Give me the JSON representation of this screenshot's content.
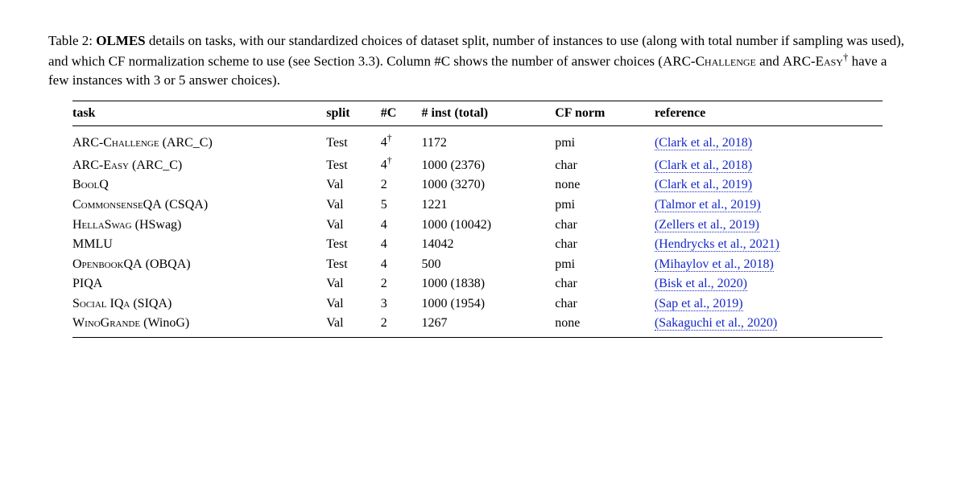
{
  "caption": {
    "prefix": "Table 2: ",
    "bold_name": "OLMES",
    "text_after_bold": " details on tasks, with our standardized choices of dataset split, number of instances to use (along with total number if sampling was used), and which CF normalization scheme to use (see Section 3.3). Column #C shows the number of answer choices (",
    "task1_sc": "ARC-Challenge",
    "and_word": " and ",
    "task2_sc": "ARC-Easy",
    "dagger": "†",
    "text_tail": " have a few instances with 3 or 5 answer choices)."
  },
  "headers": {
    "task": "task",
    "split": "split",
    "nc": "#C",
    "ninst": "# inst (total)",
    "cfnorm": "CF norm",
    "reference": "reference"
  },
  "rows": [
    {
      "task_main": "ARC-Challenge",
      "alias": "ARC_C",
      "no_sc": false,
      "split": "Test",
      "nc": "4",
      "dag": true,
      "ninst": "1172",
      "cfnorm": "pmi",
      "reference": "(Clark et al., 2018)"
    },
    {
      "task_main": "ARC-Easy",
      "alias": "ARC_C",
      "no_sc": false,
      "split": "Test",
      "nc": "4",
      "dag": true,
      "ninst": "1000 (2376)",
      "cfnorm": "char",
      "reference": "(Clark et al., 2018)"
    },
    {
      "task_main": "BoolQ",
      "alias": "",
      "no_sc": false,
      "split": "Val",
      "nc": "2",
      "dag": false,
      "ninst": "1000 (3270)",
      "cfnorm": "none",
      "reference": "(Clark et al., 2019)"
    },
    {
      "task_main": "CommonsenseQA",
      "alias": "CSQA",
      "no_sc": false,
      "split": "Val",
      "nc": "5",
      "dag": false,
      "ninst": "1221",
      "cfnorm": "pmi",
      "reference": "(Talmor et al., 2019)"
    },
    {
      "task_main": "HellaSwag",
      "alias": "HSwag",
      "no_sc": false,
      "split": "Val",
      "nc": "4",
      "dag": false,
      "ninst": "1000 (10042)",
      "cfnorm": "char",
      "reference": "(Zellers et al., 2019)"
    },
    {
      "task_main": "MMLU",
      "alias": "",
      "no_sc": true,
      "split": "Test",
      "nc": "4",
      "dag": false,
      "ninst": "14042",
      "cfnorm": "char",
      "reference": "(Hendrycks et al., 2021)"
    },
    {
      "task_main": "OpenbookQA",
      "alias": "OBQA",
      "no_sc": false,
      "split": "Test",
      "nc": "4",
      "dag": false,
      "ninst": "500",
      "cfnorm": "pmi",
      "reference": "(Mihaylov et al., 2018)"
    },
    {
      "task_main": "PIQA",
      "alias": "",
      "no_sc": true,
      "split": "Val",
      "nc": "2",
      "dag": false,
      "ninst": "1000 (1838)",
      "cfnorm": "char",
      "reference": "(Bisk et al., 2020)"
    },
    {
      "task_main": "Social IQa",
      "alias": "SIQA",
      "no_sc": false,
      "split": "Val",
      "nc": "3",
      "dag": false,
      "ninst": "1000 (1954)",
      "cfnorm": "char",
      "reference": "(Sap et al., 2019)"
    },
    {
      "task_main": "WinoGrande",
      "alias": "WinoG",
      "no_sc": false,
      "split": "Val",
      "nc": "2",
      "dag": false,
      "ninst": "1267",
      "cfnorm": "none",
      "reference": "(Sakaguchi et al., 2020)"
    }
  ]
}
